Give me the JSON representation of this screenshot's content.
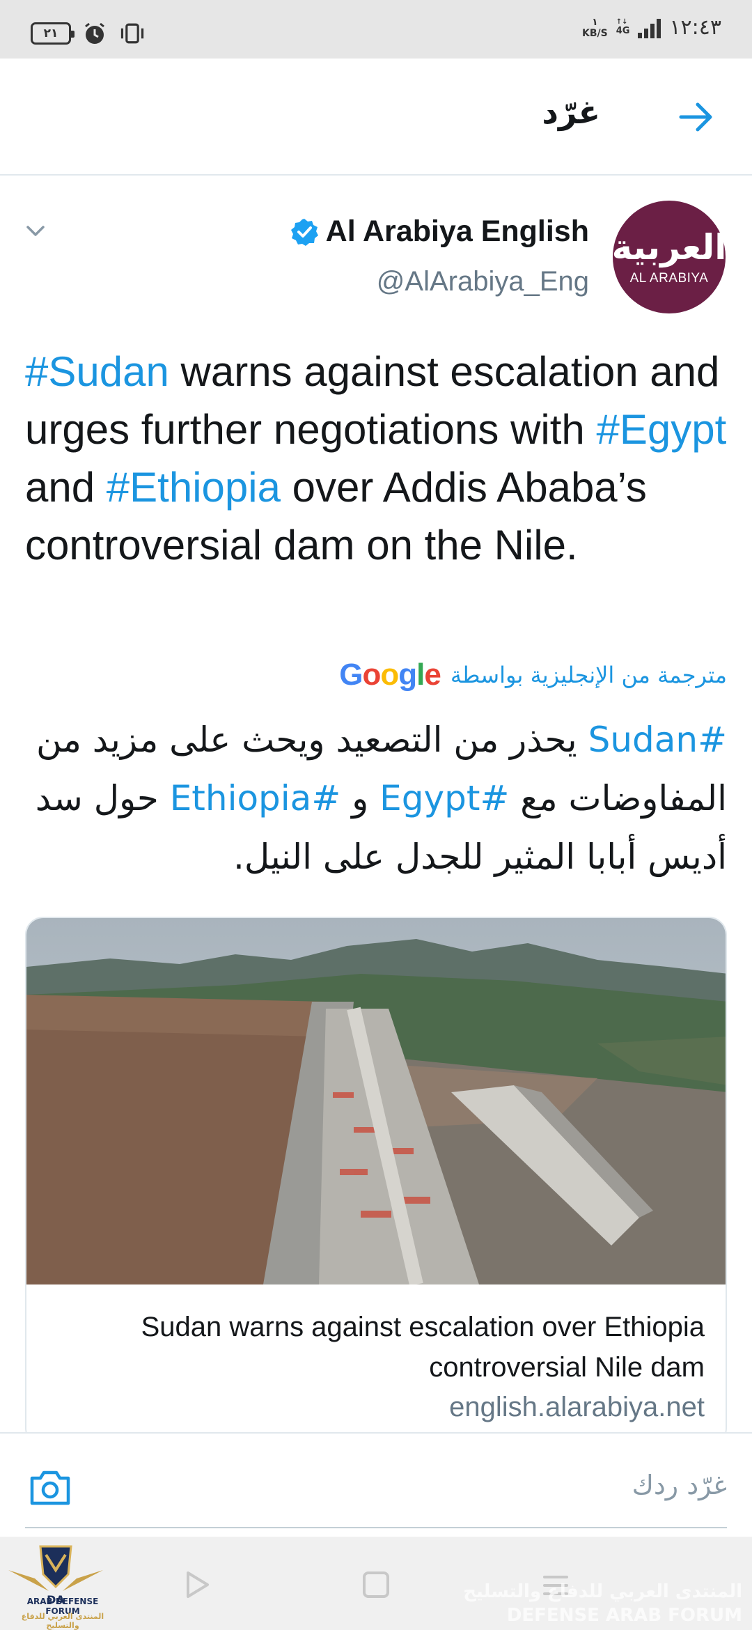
{
  "status_bar": {
    "battery": "٢١",
    "speed_value": "١",
    "speed_unit": "KB/S",
    "network": "4G",
    "time": "١٢:٤٣"
  },
  "header": {
    "title": "غرّد"
  },
  "tweet": {
    "display_name": "Al Arabiya English",
    "handle": "@AlArabiya_Eng",
    "avatar_arabic": "العربية",
    "avatar_english": "AL ARABIYA",
    "text_parts": {
      "h1": "#Sudan",
      "t1": " warns against escalation and urges further negotiations with ",
      "h2": "#Egypt",
      "t2": " and ",
      "h3": "#Ethiopia",
      "t3": " over Addis Ababa’s controversial dam on the Nile."
    },
    "translated_label": "مترجمة من الإنجليزية بواسطة",
    "google": [
      "G",
      "o",
      "o",
      "g",
      "l",
      "e"
    ],
    "translation_parts": {
      "h1": "#Sudan",
      "t1": " يحذر من التصعيد ويحث على مزيد من المفاوضات مع ",
      "h2": "#Egypt",
      "t2": " و ",
      "h3": "#Ethiopia",
      "t3": " حول سد أديس أبابا المثير للجدل على النيل."
    },
    "card": {
      "title": "Sudan warns against escalation over Ethiopia controversial Nile dam",
      "domain": "english.alarabiya.net"
    }
  },
  "reply": {
    "placeholder": "غرّد ردك"
  },
  "watermark": {
    "badge": "DA",
    "english": "ARAB DEFENSE FORUM",
    "arabic": "المنتدى العربي للدفاع والتسليح",
    "arabic_bg": "المنتدى العربي للدفاع والتسليح",
    "english_bg": "DEFENSE ARAB FORUM"
  },
  "colors": {
    "accent": "#1b95e0",
    "avatar_bg": "#6b1f45",
    "secondary_text": "#657786"
  }
}
